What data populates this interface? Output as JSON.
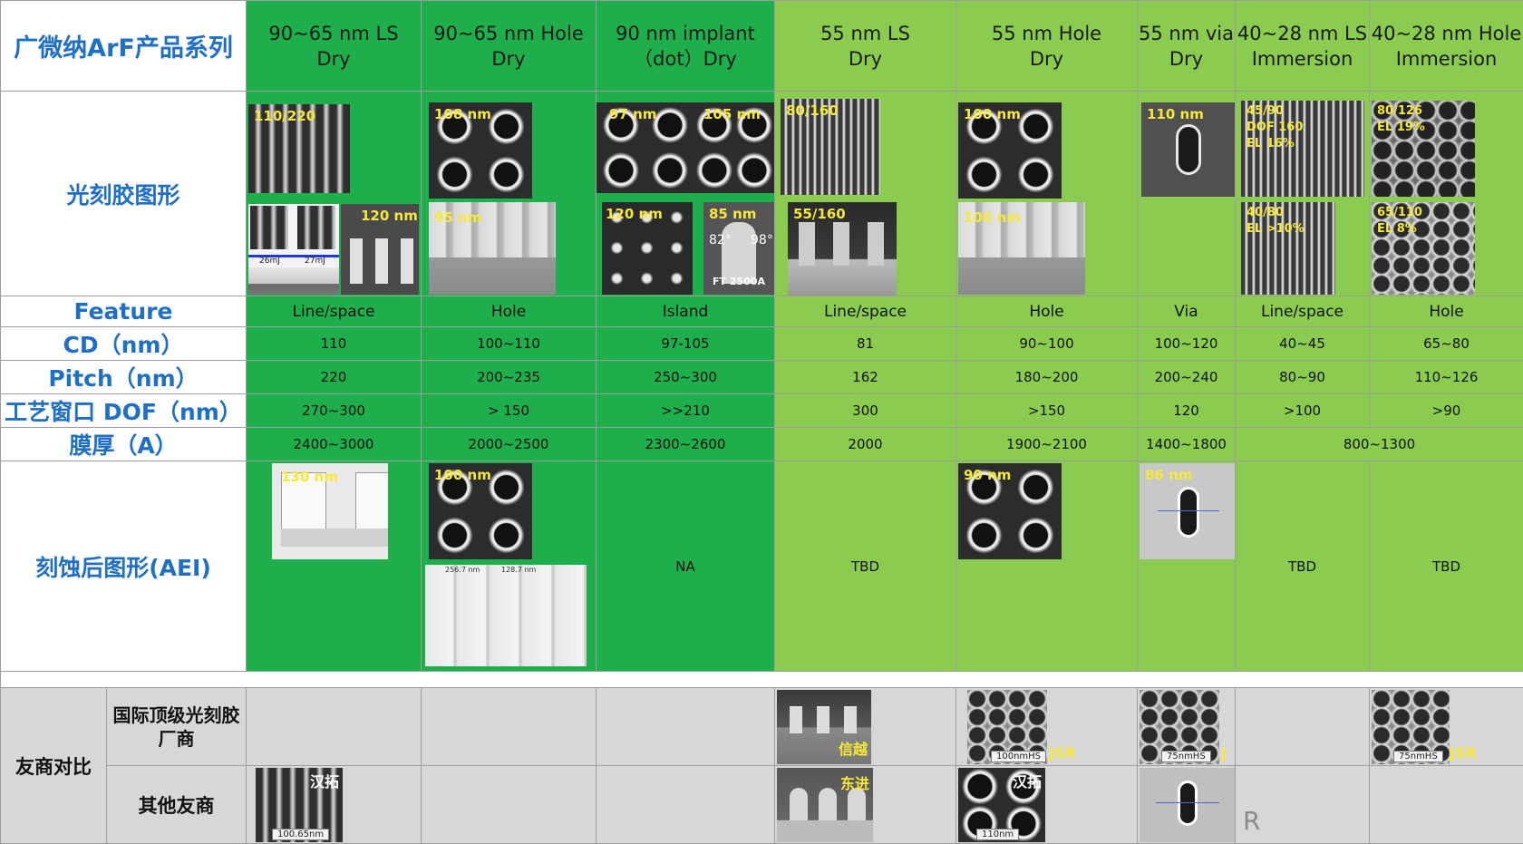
{
  "title": "广微纳ArF产品系列",
  "columns": [
    {
      "name": "90~65 nm LS",
      "sub": "Dry"
    },
    {
      "name": "90~65 nm Hole",
      "sub": "Dry"
    },
    {
      "name": "90 nm implant",
      "sub": "（dot）Dry"
    },
    {
      "name": "55 nm LS",
      "sub": "Dry"
    },
    {
      "name": "55 nm Hole",
      "sub": "Dry"
    },
    {
      "name": "55 nm via",
      "sub": "Dry"
    },
    {
      "name": "40~28 nm LS",
      "sub": "Immersion"
    },
    {
      "name": "40~28 nm Hole",
      "sub": "Immersion"
    }
  ],
  "rows": {
    "resist_pattern": "光刻胶图形",
    "feature": "Feature",
    "cd": "CD（nm）",
    "pitch": "Pitch（nm）",
    "dof": "工艺窗口 DOF（nm）",
    "thickness": "膜厚（A）",
    "aei": "刻蚀后图形(AEI)"
  },
  "feature": [
    "Line/space",
    "Hole",
    "Island",
    "Line/space",
    "Hole",
    "Via",
    "Line/space",
    "Hole"
  ],
  "cd": [
    "110",
    "100~110",
    "97-105",
    "81",
    "90~100",
    "100~120",
    "40~45",
    "65~80"
  ],
  "pitch": [
    "220",
    "200~235",
    "250~300",
    "162",
    "180~200",
    "200~240",
    "80~90",
    "110~126"
  ],
  "dof": [
    "270~300",
    "> 150",
    ">>210",
    "300",
    ">150",
    "120",
    ">100",
    ">90"
  ],
  "thickness": [
    "2400~3000",
    "2000~2500",
    "2300~2600",
    "2000",
    "1900~2100",
    "1400~1800",
    "800~1300"
  ],
  "img_labels": {
    "r1c1": "110/220",
    "r1c2": "108 nm",
    "r1c3a": "97 nm",
    "r1c3b": "105 nm",
    "r1c4": "80/160",
    "r1c5": "100 nm",
    "r1c6": "110 nm",
    "r1c7": "45/90",
    "r1c7b": "DOF 160",
    "r1c7c": "EL 16%",
    "r1c8": "80/126",
    "r1c8b": "EL 19%",
    "r2c1": "120 nm",
    "r2c1a": "26mJ",
    "r2c1b": "27mJ",
    "r2c2": "95 nm",
    "r2c3a": "120 nm",
    "r2c3b": "85 nm",
    "r2c3c": "82°",
    "r2c3d": "98°",
    "r2c3e": "FT 2500A",
    "r2c4": "55/160",
    "r2c5": "100 nm",
    "r2c7": "40/80",
    "r2c7b": "EL >10%",
    "r2c8": "65/110",
    "r2c8b": "EL 8%",
    "aei1": "130 nm",
    "aei2": "100 nm",
    "aei2a": "256.7 nm",
    "aei2b": "128.7 nm",
    "aei5": "90 nm",
    "aei6": "86 nm"
  },
  "aei_text": [
    "NA",
    "TBD",
    "TBD",
    "TBD"
  ],
  "comp": {
    "label": "友商对比",
    "intl": "国际顶级光刻胶厂商",
    "other": "其他友商",
    "c4_intl": "信越",
    "c4_other": "东进",
    "c5_intl": "JSR",
    "c5_intl_scale": "100nmHS",
    "c5_other": "汉拓",
    "c5_other_scale": "110nm",
    "c6_intl_scale": "75nmHS",
    "c6_intl": "J",
    "c7_other": "R",
    "c8_intl": "JSR",
    "c8_intl_scale": "75nmHS",
    "c1_other": "汉拓",
    "c1_other_scale": "100.65nm"
  }
}
